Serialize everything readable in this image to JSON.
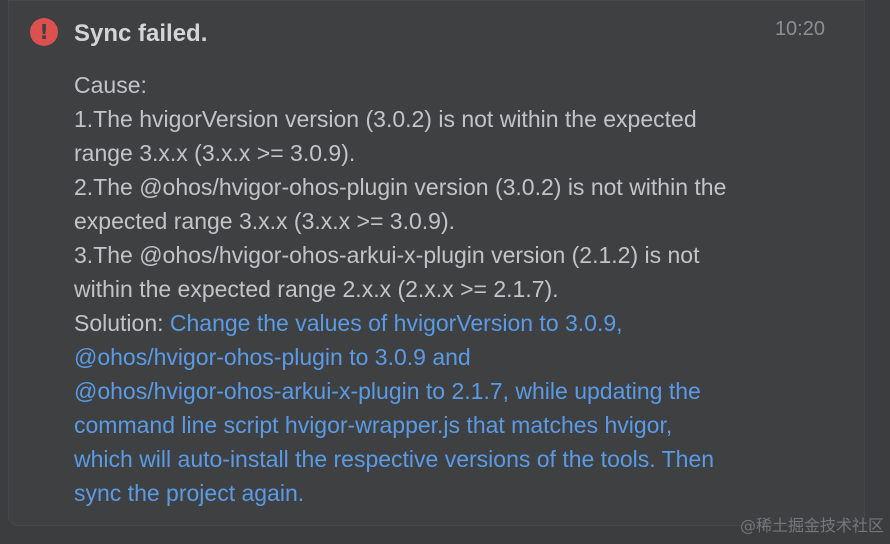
{
  "notification": {
    "title": "Sync failed.",
    "time": "10:20",
    "icon": "error-icon",
    "accent_color": "#dc504f",
    "link_color": "#5b9be6",
    "cause_label": "Cause:",
    "cause_lines": [
      "1.The hvigorVersion version (3.0.2) is not within the expected",
      "range 3.x.x (3.x.x >= 3.0.9).",
      "2.The @ohos/hvigor-ohos-plugin version (3.0.2) is not within the",
      "expected range 3.x.x (3.x.x >= 3.0.9).",
      "3.The @ohos/hvigor-ohos-arkui-x-plugin version (2.1.2) is not",
      "within the expected range 2.x.x (2.x.x >= 2.1.7)."
    ],
    "solution_label": "Solution: ",
    "solution_lines": [
      "Change the values of hvigorVersion to 3.0.9,",
      "@ohos/hvigor-ohos-plugin to 3.0.9 and",
      "@ohos/hvigor-ohos-arkui-x-plugin to 2.1.7, while updating the",
      "command line script hvigor-wrapper.js that matches hvigor,",
      "which will auto-install the respective versions of the tools. Then",
      "sync the project again."
    ]
  },
  "watermark": "@稀土掘金技术社区"
}
